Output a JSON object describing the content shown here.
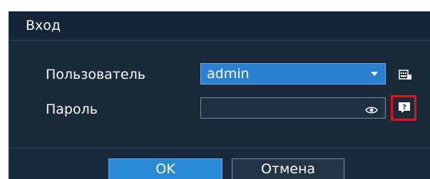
{
  "dialog": {
    "title": "Вход"
  },
  "form": {
    "user_label": "Пользователь",
    "user_value": "admin",
    "password_label": "Пароль",
    "password_value": ""
  },
  "icons": {
    "user_side": "keyboard-icon",
    "password_side": "help-icon",
    "password_toggle": "eye-icon",
    "dropdown": "chevron-down-icon"
  },
  "buttons": {
    "ok_label": "OK",
    "cancel_label": "Отмена"
  },
  "colors": {
    "dialog_bg": "#1a2a3d",
    "accent": "#2b8ad6",
    "highlight": "#e0141e"
  }
}
